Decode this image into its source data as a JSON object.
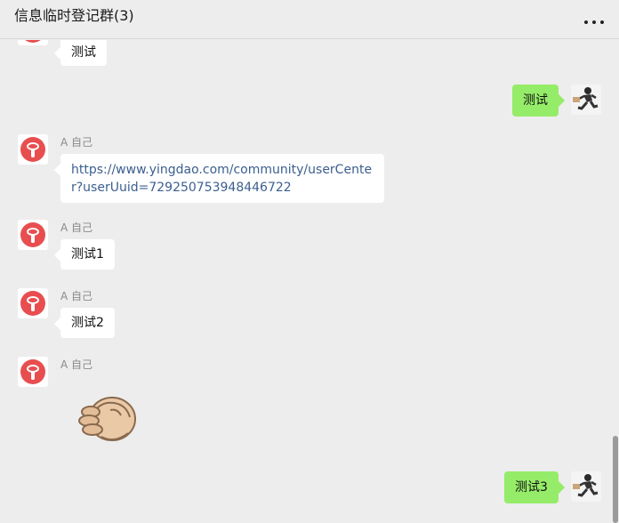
{
  "header": {
    "title": "信息临时登记群(3)",
    "more_icon": "more-dots-icon"
  },
  "messages": [
    {
      "side": "left",
      "text": "测试"
    },
    {
      "side": "right",
      "text": "测试"
    },
    {
      "side": "left",
      "sender": "A 自己",
      "text": "https://www.yingdao.com/community/userCenter?userUuid=729250753948446722"
    },
    {
      "side": "left",
      "sender": "A 自己",
      "text": "测试1"
    },
    {
      "side": "left",
      "sender": "A 自己",
      "text": "测试2"
    },
    {
      "side": "left",
      "sender": "A 自己",
      "sticker": "fist-bump-icon"
    },
    {
      "side": "right",
      "text": "测试3"
    }
  ],
  "colors": {
    "own_bubble": "#95ec69",
    "other_bubble": "#ffffff",
    "link": "#3b5f8f",
    "avatar_red": "#e84e4f"
  }
}
